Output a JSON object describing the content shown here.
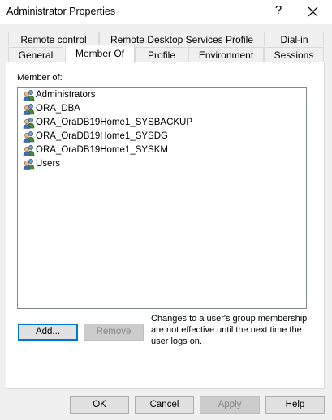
{
  "window": {
    "title": "Administrator Properties",
    "help_glyph": "?"
  },
  "tabs": {
    "row1": [
      {
        "label": "Remote control"
      },
      {
        "label": "Remote Desktop Services Profile"
      },
      {
        "label": "Dial-in"
      }
    ],
    "row2": [
      {
        "label": "General"
      },
      {
        "label": "Member Of",
        "selected": true
      },
      {
        "label": "Profile"
      },
      {
        "label": "Environment"
      },
      {
        "label": "Sessions"
      }
    ]
  },
  "member_of": {
    "label": "Member of:",
    "groups": [
      {
        "name": "Administrators",
        "icon": "group-icon"
      },
      {
        "name": "ORA_DBA",
        "icon": "group-icon"
      },
      {
        "name": "ORA_OraDB19Home1_SYSBACKUP",
        "icon": "group-icon"
      },
      {
        "name": "ORA_OraDB19Home1_SYSDG",
        "icon": "group-icon"
      },
      {
        "name": "ORA_OraDB19Home1_SYSKM",
        "icon": "group-icon"
      },
      {
        "name": "Users",
        "icon": "group-icon"
      }
    ],
    "add_label": "Add...",
    "remove_label": "Remove",
    "note": "Changes to a user's group membership are not effective until the next time the user logs on."
  },
  "footer": {
    "ok_label": "OK",
    "cancel_label": "Cancel",
    "apply_label": "Apply",
    "help_label": "Help"
  },
  "colors": {
    "dialog_bg": "#f0f0f0",
    "accent": "#0078d7",
    "disabled_text": "#838383"
  }
}
